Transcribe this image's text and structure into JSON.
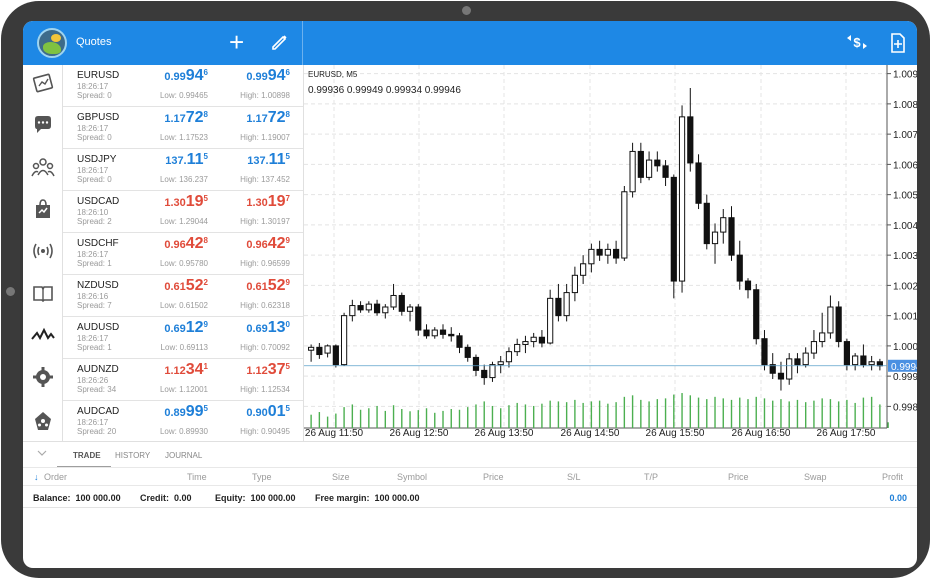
{
  "header": {
    "title": "Quotes"
  },
  "colors": {
    "accent": "#1e88e5",
    "bid_up": "#1e7fd8",
    "bid_down": "#e04b3a",
    "volume": "#4caf50"
  },
  "nav": [
    {
      "icon": "quotes-book-icon"
    },
    {
      "icon": "chat-icon"
    },
    {
      "icon": "community-icon"
    },
    {
      "icon": "market-bag-icon"
    },
    {
      "icon": "signal-broadcast-icon"
    },
    {
      "icon": "journal-book-icon"
    },
    {
      "icon": "chart-line-icon"
    },
    {
      "icon": "settings-gear-icon"
    },
    {
      "icon": "traders-community-icon"
    }
  ],
  "quotes": [
    {
      "symbol": "EURUSD",
      "time": "18:26:17",
      "spread": "Spread: 0",
      "color": "blue",
      "bid": {
        "small": "0.99",
        "big": "94",
        "sup": "6"
      },
      "ask": {
        "small": "0.99",
        "big": "94",
        "sup": "6"
      },
      "low": "Low: 0.99465",
      "high": "High: 1.00898"
    },
    {
      "symbol": "GBPUSD",
      "time": "18:26:17",
      "spread": "Spread: 0",
      "color": "blue",
      "bid": {
        "small": "1.17",
        "big": "72",
        "sup": "8"
      },
      "ask": {
        "small": "1.17",
        "big": "72",
        "sup": "8"
      },
      "low": "Low: 1.17523",
      "high": "High: 1.19007"
    },
    {
      "symbol": "USDJPY",
      "time": "18:26:17",
      "spread": "Spread: 0",
      "color": "blue",
      "bid": {
        "small": "137.",
        "big": "11",
        "sup": "5"
      },
      "ask": {
        "small": "137.",
        "big": "11",
        "sup": "5"
      },
      "low": "Low: 136.237",
      "high": "High: 137.452"
    },
    {
      "symbol": "USDCAD",
      "time": "18:26:10",
      "spread": "Spread: 2",
      "color": "red",
      "bid": {
        "small": "1.30",
        "big": "19",
        "sup": "5"
      },
      "ask": {
        "small": "1.30",
        "big": "19",
        "sup": "7"
      },
      "low": "Low: 1.29044",
      "high": "High: 1.30197"
    },
    {
      "symbol": "USDCHF",
      "time": "18:26:17",
      "spread": "Spread: 1",
      "color": "red",
      "bid": {
        "small": "0.96",
        "big": "42",
        "sup": "8"
      },
      "ask": {
        "small": "0.96",
        "big": "42",
        "sup": "9"
      },
      "low": "Low: 0.95780",
      "high": "High: 0.96599"
    },
    {
      "symbol": "NZDUSD",
      "time": "18:26:16",
      "spread": "Spread: 7",
      "color": "red",
      "bid": {
        "small": "0.61",
        "big": "52",
        "sup": "2"
      },
      "ask": {
        "small": "0.61",
        "big": "52",
        "sup": "9"
      },
      "low": "Low: 0.61502",
      "high": "High: 0.62318"
    },
    {
      "symbol": "AUDUSD",
      "time": "18:26:17",
      "spread": "Spread: 1",
      "color": "blue",
      "bid": {
        "small": "0.69",
        "big": "12",
        "sup": "9"
      },
      "ask": {
        "small": "0.69",
        "big": "13",
        "sup": "0"
      },
      "low": "Low: 0.69113",
      "high": "High: 0.70092"
    },
    {
      "symbol": "AUDNZD",
      "time": "18:26:26",
      "spread": "Spread: 34",
      "color": "red",
      "bid": {
        "small": "1.12",
        "big": "34",
        "sup": "1"
      },
      "ask": {
        "small": "1.12",
        "big": "37",
        "sup": "5"
      },
      "low": "Low: 1.12001",
      "high": "High: 1.12534"
    },
    {
      "symbol": "AUDCAD",
      "time": "18:26:17",
      "spread": "Spread: 20",
      "color": "blue",
      "bid": {
        "small": "0.89",
        "big": "99",
        "sup": "5"
      },
      "ask": {
        "small": "0.90",
        "big": "01",
        "sup": "5"
      },
      "low": "Low: 0.89930",
      "high": "High: 0.90495"
    }
  ],
  "chart": {
    "symbol": "EURUSD, M5",
    "ohlc": "0.99936 0.99949 0.99934 0.99946",
    "current_price": "0.99946"
  },
  "chart_data": {
    "type": "candlestick",
    "y_ticks": [
      "1.00960",
      "1.00855",
      "1.00750",
      "1.00645",
      "1.00540",
      "1.00435",
      "1.00330",
      "1.00225",
      "1.00120",
      "1.00015",
      "0.99910",
      "0.99805"
    ],
    "x_ticks": [
      "26 Aug 11:50",
      "26 Aug 12:50",
      "26 Aug 13:50",
      "26 Aug 14:50",
      "26 Aug 15:50",
      "26 Aug 16:50",
      "26 Aug 17:50"
    ],
    "ylim": [
      0.9973,
      1.0099
    ],
    "current": 0.99946,
    "candles": [
      [
        1.0,
        1.0002,
        0.9996,
        1.0001
      ],
      [
        1.0001,
        1.00025,
        0.9997,
        0.99985
      ],
      [
        0.9999,
        1.0002,
        0.99975,
        1.00015
      ],
      [
        1.00015,
        1.0002,
        0.9994,
        0.9995
      ],
      [
        0.9995,
        1.0013,
        0.99945,
        1.0012
      ],
      [
        1.0012,
        1.00175,
        1.001,
        1.00155
      ],
      [
        1.00155,
        1.0017,
        1.0013,
        1.0014
      ],
      [
        1.0014,
        1.0017,
        1.0013,
        1.0016
      ],
      [
        1.0016,
        1.00175,
        1.0012,
        1.0013
      ],
      [
        1.0013,
        1.0016,
        1.0011,
        1.0015
      ],
      [
        1.0015,
        1.0023,
        1.0014,
        1.0019
      ],
      [
        1.0019,
        1.002,
        1.0012,
        1.00135
      ],
      [
        1.00135,
        1.0016,
        1.001,
        1.0015
      ],
      [
        1.0015,
        1.0016,
        1.0005,
        1.0007
      ],
      [
        1.0007,
        1.0009,
        1.0004,
        1.0005
      ],
      [
        1.0005,
        1.0008,
        1.0004,
        1.0007
      ],
      [
        1.0007,
        1.0009,
        1.0004,
        1.00055
      ],
      [
        1.00055,
        1.0008,
        1.0003,
        1.0005
      ],
      [
        1.0005,
        1.0006,
        0.9999,
        1.0001
      ],
      [
        1.0001,
        1.0002,
        0.9996,
        0.99975
      ],
      [
        0.99975,
        0.99985,
        0.9991,
        0.9993
      ],
      [
        0.9993,
        0.9995,
        0.9988,
        0.99905
      ],
      [
        0.99905,
        0.9996,
        0.9989,
        0.9995
      ],
      [
        0.9995,
        0.9998,
        0.9992,
        0.9996
      ],
      [
        0.9996,
        1.0001,
        0.9994,
        0.99995
      ],
      [
        0.99995,
        1.0004,
        0.9998,
        1.0002
      ],
      [
        1.0002,
        1.0005,
        0.9999,
        1.0003
      ],
      [
        1.0003,
        1.0006,
        1.0001,
        1.00045
      ],
      [
        1.00045,
        1.0007,
        1.0001,
        1.00025
      ],
      [
        1.00025,
        1.0021,
        1.0002,
        1.0018
      ],
      [
        1.0018,
        1.0023,
        1.001,
        1.0012
      ],
      [
        1.0012,
        1.0023,
        1.001,
        1.002
      ],
      [
        1.002,
        1.0029,
        1.0017,
        1.0026
      ],
      [
        1.0026,
        1.0033,
        1.0023,
        1.003
      ],
      [
        1.003,
        1.0037,
        1.0027,
        1.0035
      ],
      [
        1.0035,
        1.0038,
        1.0031,
        1.0033
      ],
      [
        1.0033,
        1.0037,
        1.003,
        1.0035
      ],
      [
        1.0035,
        1.0038,
        1.003,
        1.0032
      ],
      [
        1.0032,
        1.0057,
        1.0031,
        1.0055
      ],
      [
        1.0055,
        1.0072,
        1.0053,
        1.0069
      ],
      [
        1.0069,
        1.0072,
        1.0058,
        1.006
      ],
      [
        1.006,
        1.0069,
        1.0059,
        1.0066
      ],
      [
        1.0066,
        1.0069,
        1.0062,
        1.0064
      ],
      [
        1.0064,
        1.0066,
        1.0057,
        1.006
      ],
      [
        1.006,
        1.0061,
        1.0018,
        1.0024
      ],
      [
        1.0024,
        1.0085,
        1.002,
        1.0081
      ],
      [
        1.0081,
        1.0091,
        1.0062,
        1.0065
      ],
      [
        1.0065,
        1.0068,
        1.0049,
        1.0051
      ],
      [
        1.0051,
        1.0054,
        1.0035,
        1.0037
      ],
      [
        1.0037,
        1.0044,
        1.003,
        1.0041
      ],
      [
        1.0041,
        1.0049,
        1.0037,
        1.0046
      ],
      [
        1.0046,
        1.005,
        1.0031,
        1.0033
      ],
      [
        1.0033,
        1.0038,
        1.0021,
        1.0024
      ],
      [
        1.0024,
        1.0025,
        1.0018,
        1.0021
      ],
      [
        1.0021,
        1.0023,
        1.0002,
        1.0004
      ],
      [
        1.0004,
        1.0007,
        0.9993,
        0.9995
      ],
      [
        0.9995,
        0.9999,
        0.999,
        0.9992
      ],
      [
        0.9992,
        0.9996,
        0.9986,
        0.999
      ],
      [
        0.999,
        0.9999,
        0.9988,
        0.9997
      ],
      [
        0.9997,
        0.9999,
        0.9992,
        0.9995
      ],
      [
        0.9995,
        1.0001,
        0.9994,
        0.9999
      ],
      [
        0.9999,
        1.0007,
        0.9997,
        1.0003
      ],
      [
        1.0003,
        1.0013,
        1.0001,
        1.0006
      ],
      [
        1.0006,
        1.0019,
        1.0004,
        1.0015
      ],
      [
        1.0015,
        1.0017,
        1.0001,
        1.0003
      ],
      [
        1.0003,
        1.0004,
        0.9993,
        0.9995
      ],
      [
        0.9995,
        0.9999,
        0.9993,
        0.9998
      ],
      [
        0.9998,
        1.0002,
        0.9994,
        0.9995
      ],
      [
        0.9995,
        0.9998,
        0.9993,
        0.9996
      ],
      [
        0.9996,
        0.9997,
        0.9993,
        0.99946
      ]
    ],
    "volumes": [
      0.35,
      0.42,
      0.3,
      0.38,
      0.55,
      0.62,
      0.48,
      0.52,
      0.58,
      0.45,
      0.6,
      0.5,
      0.44,
      0.47,
      0.52,
      0.4,
      0.45,
      0.5,
      0.48,
      0.55,
      0.62,
      0.7,
      0.58,
      0.52,
      0.6,
      0.66,
      0.62,
      0.58,
      0.64,
      0.72,
      0.7,
      0.68,
      0.74,
      0.66,
      0.7,
      0.72,
      0.64,
      0.68,
      0.82,
      0.86,
      0.74,
      0.7,
      0.76,
      0.78,
      0.88,
      0.92,
      0.86,
      0.8,
      0.76,
      0.82,
      0.78,
      0.74,
      0.8,
      0.76,
      0.82,
      0.78,
      0.72,
      0.76,
      0.7,
      0.74,
      0.68,
      0.72,
      0.78,
      0.76,
      0.7,
      0.74,
      0.66,
      0.8,
      0.82,
      0.62,
      0.15
    ]
  },
  "bottom": {
    "tabs": [
      "TRADE",
      "HISTORY",
      "JOURNAL"
    ],
    "columns": [
      "Order",
      "Time",
      "Type",
      "Size",
      "Symbol",
      "Price",
      "S/L",
      "T/P",
      "Price",
      "Swap",
      "Profit"
    ],
    "balance_label": "Balance:",
    "balance_value": "100 000.00",
    "credit_label": "Credit:",
    "credit_value": "0.00",
    "equity_label": "Equity:",
    "equity_value": "100 000.00",
    "free_margin_label": "Free margin:",
    "free_margin_value": "100 000.00",
    "profit_total": "0.00"
  }
}
